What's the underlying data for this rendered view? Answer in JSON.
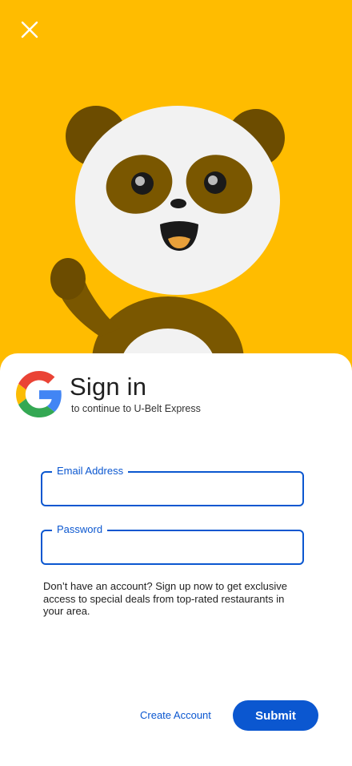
{
  "header": {
    "close_icon": "close-icon",
    "mascot": "panda-mascot-waving"
  },
  "signin": {
    "logo": "google-g-logo",
    "title": "Sign in",
    "subtitle": "to continue to U-Belt Express"
  },
  "form": {
    "email_label": "Email Address",
    "email_value": "",
    "password_label": "Password",
    "password_value": ""
  },
  "info_text": "Don’t have an account? Sign up now to get exclusive access to special deals from top-rated restaurants in your area.",
  "actions": {
    "create_account_label": "Create Account",
    "submit_label": "Submit"
  },
  "colors": {
    "background": "#FFBC00",
    "accent": "#0B57D0",
    "panda_dark": "#7A5700",
    "panda_light": "#F2F2F2"
  }
}
